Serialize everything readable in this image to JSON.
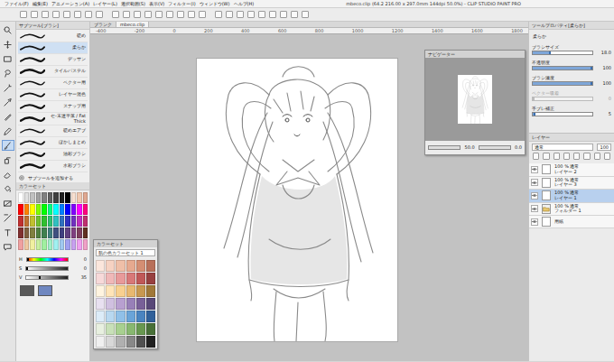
{
  "window": {
    "title": "mbeco.clip (64.2 216.00 x 297.0mm 144dpi 50.0%) - CLIP STUDIO PAINT PRO"
  },
  "menu": [
    "ファイル(F)",
    "編集(E)",
    "アニメーション(A)",
    "レイヤー(L)",
    "選択範囲(S)",
    "表示(V)",
    "フィルター(I)",
    "ウィンドウ(W)",
    "ヘルプ(H)"
  ],
  "tools": [
    {
      "kind": "zoom",
      "selected": false
    },
    {
      "kind": "hand",
      "selected": false
    },
    {
      "kind": "select",
      "selected": false
    },
    {
      "kind": "lasso",
      "selected": false
    },
    {
      "kind": "wand",
      "selected": false
    },
    {
      "kind": "eyedrop",
      "selected": false
    },
    {
      "kind": "pen",
      "selected": false
    },
    {
      "kind": "pencil",
      "selected": false
    },
    {
      "kind": "brush",
      "selected": true
    },
    {
      "kind": "airbrush",
      "selected": false
    },
    {
      "kind": "eraser",
      "selected": false
    },
    {
      "kind": "fill",
      "selected": false
    },
    {
      "kind": "gradient",
      "selected": false
    },
    {
      "kind": "figure",
      "selected": false
    },
    {
      "kind": "text",
      "selected": false
    },
    {
      "kind": "balloon",
      "selected": false
    }
  ],
  "subtool": {
    "title": "サブツール[ブラシ]",
    "items": [
      {
        "label": "硬め",
        "selected": false
      },
      {
        "label": "柔らか",
        "selected": true
      },
      {
        "label": "デッサン",
        "selected": false
      },
      {
        "label": "タイルパステル",
        "selected": false
      },
      {
        "label": "ベクター用",
        "selected": false
      },
      {
        "label": "レイヤー混色",
        "selected": false
      },
      {
        "label": "スナップ用",
        "selected": false
      },
      {
        "label": "セ-末迷平落 / Fat Thick",
        "selected": false
      },
      {
        "label": "硬めエアブ",
        "selected": false
      },
      {
        "label": "ぼかしまとめ",
        "selected": false
      },
      {
        "label": "油彩ブラシ",
        "selected": false
      },
      {
        "label": "水彩ブラシ",
        "selected": false
      }
    ],
    "add": "サブツールを追加する"
  },
  "palette": {
    "title": "カラーセット",
    "swatches": [
      {
        "color": "#ffffff"
      },
      {
        "color": "#e0e0e0"
      },
      {
        "color": "#c0c0c0"
      },
      {
        "color": "#a0a0a0"
      },
      {
        "color": "#808080"
      },
      {
        "color": "#606060"
      },
      {
        "color": "#404040"
      },
      {
        "color": "#202020"
      },
      {
        "color": "#000000"
      },
      {
        "color": "#f8e0d0"
      },
      {
        "color": "#f0c8b0"
      },
      {
        "color": "#e0a890"
      },
      {
        "color": "#ff0000"
      },
      {
        "color": "#ff8000"
      },
      {
        "color": "#ffff00"
      },
      {
        "color": "#80ff00"
      },
      {
        "color": "#00ff00"
      },
      {
        "color": "#00ff80"
      },
      {
        "color": "#00ffff"
      },
      {
        "color": "#0080ff"
      },
      {
        "color": "#0000ff"
      },
      {
        "color": "#8000ff"
      },
      {
        "color": "#ff00ff"
      },
      {
        "color": "#ff0080"
      },
      {
        "color": "#c03030"
      },
      {
        "color": "#c07030"
      },
      {
        "color": "#c0c030"
      },
      {
        "color": "#70c030"
      },
      {
        "color": "#30c030"
      },
      {
        "color": "#30c070"
      },
      {
        "color": "#30c0c0"
      },
      {
        "color": "#3070c0"
      },
      {
        "color": "#3030c0"
      },
      {
        "color": "#7030c0"
      },
      {
        "color": "#c030c0"
      },
      {
        "color": "#c03070"
      },
      {
        "color": "#803030"
      },
      {
        "color": "#806040"
      },
      {
        "color": "#808040"
      },
      {
        "color": "#508040"
      },
      {
        "color": "#408050"
      },
      {
        "color": "#408080"
      },
      {
        "color": "#405080"
      },
      {
        "color": "#404080"
      },
      {
        "color": "#604080"
      },
      {
        "color": "#804080"
      },
      {
        "color": "#804060"
      },
      {
        "color": "#603020"
      },
      {
        "color": "#f0a0a0"
      },
      {
        "color": "#f0c8a0"
      },
      {
        "color": "#f0f0a0"
      },
      {
        "color": "#c8f0a0"
      },
      {
        "color": "#a0f0a0"
      },
      {
        "color": "#a0f0c8"
      },
      {
        "color": "#a0f0f0"
      },
      {
        "color": "#a0c8f0"
      },
      {
        "color": "#a0a0f0"
      },
      {
        "color": "#c8a0f0"
      },
      {
        "color": "#f0a0f0"
      },
      {
        "color": "#f0a0c8"
      }
    ]
  },
  "sliders": [
    {
      "label": "H",
      "level": 0.0,
      "reading": "0"
    },
    {
      "label": "S",
      "level": 0.0,
      "reading": "0"
    },
    {
      "label": "V",
      "level": 0.35,
      "reading": "35"
    }
  ],
  "color_boxes": [
    {
      "color": "#595959"
    },
    {
      "color": "#6f87c0"
    }
  ],
  "doc_tabs": [
    {
      "label": "ブランク",
      "selected": false
    },
    {
      "label": "mbeco.clip",
      "selected": true
    }
  ],
  "ruler": [
    "-400",
    "-200",
    "0",
    "200",
    "400",
    "600",
    "800",
    "1000",
    "1200",
    "1400",
    "1600",
    "1800"
  ],
  "navigator": {
    "title": "ナビゲーター",
    "zoom": "50.0",
    "angle": "0.0"
  },
  "float_palette": {
    "title": "カラーセット",
    "set_name": "肌の色カラーセット 1",
    "swatches": [
      {
        "color": "#fbe6dc"
      },
      {
        "color": "#f6d2c2"
      },
      {
        "color": "#efbfa8"
      },
      {
        "color": "#e6a98f"
      },
      {
        "color": "#d48e73"
      },
      {
        "color": "#b8705a"
      },
      {
        "color": "#f7d9d9"
      },
      {
        "color": "#f0b8b8"
      },
      {
        "color": "#e89a9a"
      },
      {
        "color": "#d87878"
      },
      {
        "color": "#c05858"
      },
      {
        "color": "#984040"
      },
      {
        "color": "#fff4e0"
      },
      {
        "color": "#ffe4b8"
      },
      {
        "color": "#f8d090"
      },
      {
        "color": "#e8b870"
      },
      {
        "color": "#c89850"
      },
      {
        "color": "#a07838"
      },
      {
        "color": "#e8e0f0"
      },
      {
        "color": "#d0c0e0"
      },
      {
        "color": "#b8a0d0"
      },
      {
        "color": "#9880b8"
      },
      {
        "color": "#786098"
      },
      {
        "color": "#584878"
      },
      {
        "color": "#dcecf8"
      },
      {
        "color": "#b8d8f0"
      },
      {
        "color": "#90c0e8"
      },
      {
        "color": "#6aa4d8"
      },
      {
        "color": "#4a84c0"
      },
      {
        "color": "#30609a"
      },
      {
        "color": "#e8f0e0"
      },
      {
        "color": "#c8e0b8"
      },
      {
        "color": "#a8d090"
      },
      {
        "color": "#88b870"
      },
      {
        "color": "#689850"
      },
      {
        "color": "#487038"
      },
      {
        "color": "#f0f0f0"
      },
      {
        "color": "#d8d8d8"
      },
      {
        "color": "#b0b0b0"
      },
      {
        "color": "#888888"
      },
      {
        "color": "#505050"
      },
      {
        "color": "#202020"
      }
    ]
  },
  "tool_property": {
    "title": "ツールプロパティ[柔らか]",
    "subtool": "柔らか",
    "rows": [
      {
        "label": "ブラシサイズ",
        "reading": "18.0",
        "level": 0.3,
        "disabled": false
      },
      {
        "label": "不透明度",
        "reading": "100",
        "level": 1.0,
        "disabled": false
      },
      {
        "label": "ブラシ濃度",
        "reading": "100",
        "level": 1.0,
        "disabled": false
      },
      {
        "label": "ベクター吸着",
        "reading": "0",
        "level": 0.0,
        "disabled": true
      },
      {
        "label": "手ブレ補正",
        "reading": "5",
        "level": 0.05,
        "disabled": false
      }
    ]
  },
  "layers": {
    "title": "レイヤー",
    "blend": "通常",
    "opacity": "100",
    "items": [
      {
        "kind": "layer",
        "mode": "100 % 通常",
        "name": "レイヤー 2",
        "visible": true,
        "selected": false
      },
      {
        "kind": "layer",
        "mode": "100 % 通常",
        "name": "レイヤー 3",
        "visible": true,
        "selected": false
      },
      {
        "kind": "layer",
        "mode": "100 % 通常",
        "name": "レイヤー 1",
        "visible": true,
        "selected": true
      },
      {
        "kind": "folder",
        "mode": "100 % 通常",
        "name": "フォルダー 1",
        "visible": true,
        "selected": false
      },
      {
        "kind": "paper",
        "name": "用紙",
        "visible": true,
        "selected": false
      }
    ]
  }
}
